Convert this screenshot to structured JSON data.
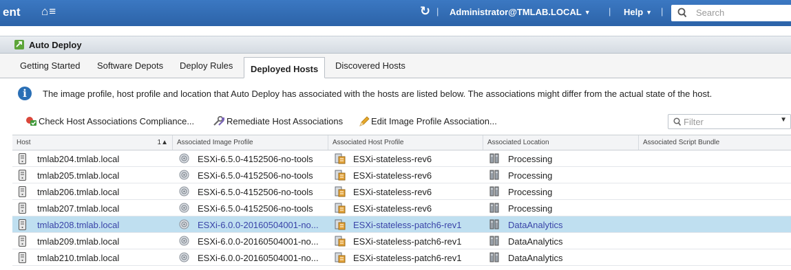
{
  "header": {
    "app_fragment": "ent",
    "home_menu": "⌂≡",
    "refresh_icon": "refresh-icon",
    "user": "Administrator@TMLAB.LOCAL",
    "help": "Help",
    "search_placeholder": "Search",
    "colors": {
      "bar": "#2f6aad",
      "text": "#ffffff"
    }
  },
  "panel": {
    "title": "Auto Deploy"
  },
  "tabs": [
    {
      "label": "Getting Started",
      "active": false
    },
    {
      "label": "Software Depots",
      "active": false
    },
    {
      "label": "Deploy Rules",
      "active": false
    },
    {
      "label": "Deployed Hosts",
      "active": true
    },
    {
      "label": "Discovered Hosts",
      "active": false
    }
  ],
  "info": {
    "text": "The image profile, host profile and location that Auto Deploy has associated with the hosts are listed below. The associations might differ from the actual state of the host."
  },
  "toolbar": {
    "check_compliance": "Check Host Associations Compliance...",
    "remediate": "Remediate Host Associations",
    "edit_image_profile": "Edit Image Profile Association...",
    "filter_placeholder": "Filter"
  },
  "grid": {
    "columns": [
      {
        "label": "Host",
        "sort": "1▲"
      },
      {
        "label": "Associated Image Profile"
      },
      {
        "label": "Associated Host Profile"
      },
      {
        "label": "Associated Location"
      },
      {
        "label": "Associated Script Bundle"
      }
    ],
    "rows": [
      {
        "host": "tmlab204.tmlab.local",
        "image_profile": "ESXi-6.5.0-4152506-no-tools",
        "host_profile": "ESXi-stateless-rev6",
        "location": "Processing",
        "script_bundle": "",
        "selected": false
      },
      {
        "host": "tmlab205.tmlab.local",
        "image_profile": "ESXi-6.5.0-4152506-no-tools",
        "host_profile": "ESXi-stateless-rev6",
        "location": "Processing",
        "script_bundle": "",
        "selected": false
      },
      {
        "host": "tmlab206.tmlab.local",
        "image_profile": "ESXi-6.5.0-4152506-no-tools",
        "host_profile": "ESXi-stateless-rev6",
        "location": "Processing",
        "script_bundle": "",
        "selected": false
      },
      {
        "host": "tmlab207.tmlab.local",
        "image_profile": "ESXi-6.5.0-4152506-no-tools",
        "host_profile": "ESXi-stateless-rev6",
        "location": "Processing",
        "script_bundle": "",
        "selected": false
      },
      {
        "host": "tmlab208.tmlab.local",
        "image_profile": "ESXi-6.0.0-20160504001-no...",
        "host_profile": "ESXi-stateless-patch6-rev1",
        "location": "DataAnalytics",
        "script_bundle": "",
        "selected": true
      },
      {
        "host": "tmlab209.tmlab.local",
        "image_profile": "ESXi-6.0.0-20160504001-no...",
        "host_profile": "ESXi-stateless-patch6-rev1",
        "location": "DataAnalytics",
        "script_bundle": "",
        "selected": false
      },
      {
        "host": "tmlab210.tmlab.local",
        "image_profile": "ESXi-6.0.0-20160504001-no...",
        "host_profile": "ESXi-stateless-patch6-rev1",
        "location": "DataAnalytics",
        "script_bundle": "",
        "selected": false
      }
    ]
  }
}
